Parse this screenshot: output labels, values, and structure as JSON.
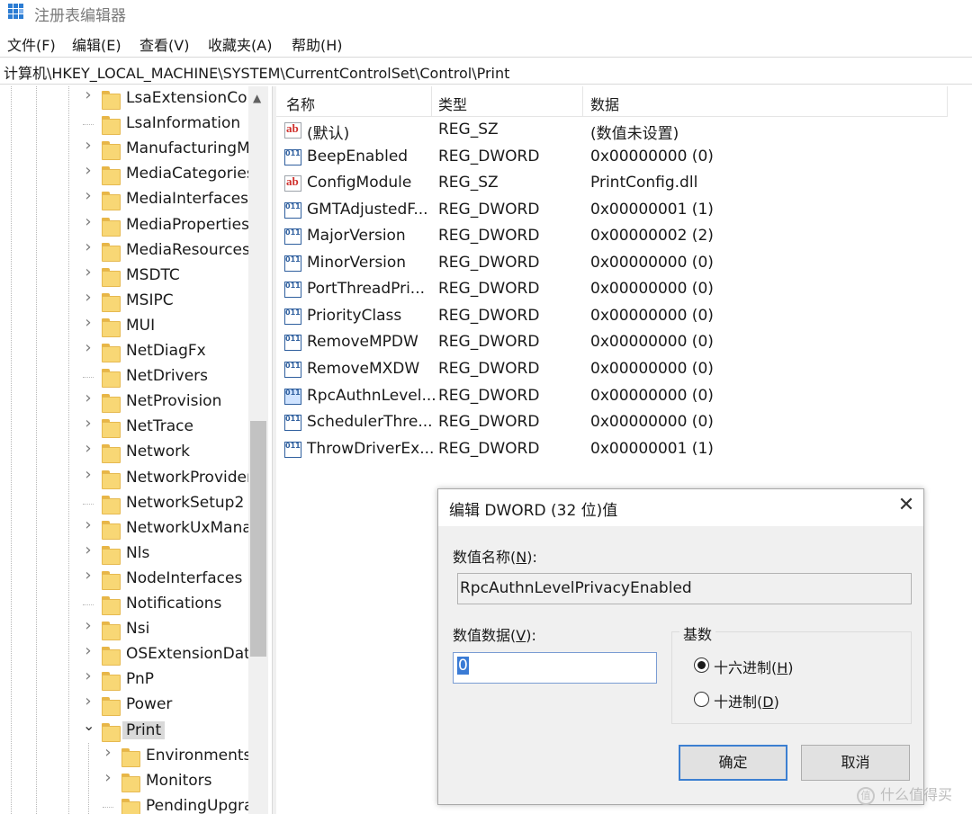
{
  "window": {
    "title": "注册表编辑器"
  },
  "menu": [
    "文件(F)",
    "编辑(E)",
    "查看(V)",
    "收藏夹(A)",
    "帮助(H)"
  ],
  "address": "计算机\\HKEY_LOCAL_MACHINE\\SYSTEM\\CurrentControlSet\\Control\\Print",
  "tree": {
    "items": [
      {
        "label": "LsaExtensionCon",
        "expandable": true
      },
      {
        "label": "LsaInformation",
        "expandable": false
      },
      {
        "label": "ManufacturingM",
        "expandable": true
      },
      {
        "label": "MediaCategories",
        "expandable": true
      },
      {
        "label": "MediaInterfaces",
        "expandable": true
      },
      {
        "label": "MediaProperties",
        "expandable": true
      },
      {
        "label": "MediaResources",
        "expandable": true
      },
      {
        "label": "MSDTC",
        "expandable": true
      },
      {
        "label": "MSIPC",
        "expandable": true
      },
      {
        "label": "MUI",
        "expandable": true
      },
      {
        "label": "NetDiagFx",
        "expandable": true
      },
      {
        "label": "NetDrivers",
        "expandable": false
      },
      {
        "label": "NetProvision",
        "expandable": true
      },
      {
        "label": "NetTrace",
        "expandable": true
      },
      {
        "label": "Network",
        "expandable": true
      },
      {
        "label": "NetworkProvider",
        "expandable": true
      },
      {
        "label": "NetworkSetup2",
        "expandable": false
      },
      {
        "label": "NetworkUxMana",
        "expandable": true
      },
      {
        "label": "Nls",
        "expandable": true
      },
      {
        "label": "NodeInterfaces",
        "expandable": true
      },
      {
        "label": "Notifications",
        "expandable": false
      },
      {
        "label": "Nsi",
        "expandable": true
      },
      {
        "label": "OSExtensionData",
        "expandable": true
      },
      {
        "label": "PnP",
        "expandable": true
      },
      {
        "label": "Power",
        "expandable": true
      },
      {
        "label": "Print",
        "expandable": true,
        "expanded": true,
        "selected": true
      },
      {
        "label": "Environments",
        "expandable": true,
        "child": true
      },
      {
        "label": "Monitors",
        "expandable": true,
        "child": true
      },
      {
        "label": "PendingUpgra",
        "expandable": false,
        "child": true
      }
    ]
  },
  "list": {
    "columns": [
      "名称",
      "类型",
      "数据"
    ],
    "rows": [
      {
        "name": "(默认)",
        "type": "REG_SZ",
        "data": "(数值未设置)",
        "icon": "string-value-icon"
      },
      {
        "name": "BeepEnabled",
        "type": "REG_DWORD",
        "data": "0x00000000 (0)",
        "icon": "dword-value-icon"
      },
      {
        "name": "ConfigModule",
        "type": "REG_SZ",
        "data": "PrintConfig.dll",
        "icon": "string-value-icon"
      },
      {
        "name": "GMTAdjustedF...",
        "type": "REG_DWORD",
        "data": "0x00000001 (1)",
        "icon": "dword-value-icon"
      },
      {
        "name": "MajorVersion",
        "type": "REG_DWORD",
        "data": "0x00000002 (2)",
        "icon": "dword-value-icon"
      },
      {
        "name": "MinorVersion",
        "type": "REG_DWORD",
        "data": "0x00000000 (0)",
        "icon": "dword-value-icon"
      },
      {
        "name": "PortThreadPri...",
        "type": "REG_DWORD",
        "data": "0x00000000 (0)",
        "icon": "dword-value-icon"
      },
      {
        "name": "PriorityClass",
        "type": "REG_DWORD",
        "data": "0x00000000 (0)",
        "icon": "dword-value-icon"
      },
      {
        "name": "RemoveMPDW",
        "type": "REG_DWORD",
        "data": "0x00000000 (0)",
        "icon": "dword-value-icon"
      },
      {
        "name": "RemoveMXDW",
        "type": "REG_DWORD",
        "data": "0x00000000 (0)",
        "icon": "dword-value-icon"
      },
      {
        "name": "RpcAuthnLevel...",
        "type": "REG_DWORD",
        "data": "0x00000000 (0)",
        "icon": "dword-value-icon",
        "highlighted": true
      },
      {
        "name": "SchedulerThre...",
        "type": "REG_DWORD",
        "data": "0x00000000 (0)",
        "icon": "dword-value-icon"
      },
      {
        "name": "ThrowDriverEx...",
        "type": "REG_DWORD",
        "data": "0x00000001 (1)",
        "icon": "dword-value-icon"
      }
    ]
  },
  "dialog": {
    "title": "编辑 DWORD (32 位)值",
    "close": "✕",
    "name_label": "数值名称",
    "name_key": "N",
    "name_value": "RpcAuthnLevelPrivacyEnabled",
    "data_label": "数值数据",
    "data_key": "V",
    "data_value": "0",
    "base_label": "基数",
    "hex_label": "十六进制",
    "hex_key": "H",
    "dec_label": "十进制",
    "dec_key": "D",
    "selected_base": "hex",
    "ok_label": "确定",
    "cancel_label": "取消"
  },
  "watermark": {
    "text": "什么值得买",
    "badge": "值"
  },
  "colors": {
    "accent": "#3c7fd1",
    "folder": "#f8d775",
    "selection": "#d9d9d9"
  }
}
